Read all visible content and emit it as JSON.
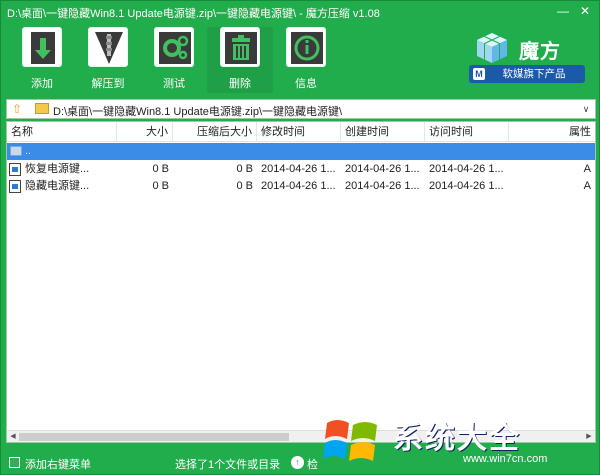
{
  "window": {
    "title": "D:\\桌面\\一键隐藏Win8.1 Update电源键.zip\\一键隐藏电源键\\ - 魔方压缩 v1.08",
    "minimize": "—",
    "close": "✕"
  },
  "toolbar": {
    "buttons": [
      {
        "label": "添加",
        "icon": "add-icon"
      },
      {
        "label": "解压到",
        "icon": "extract-icon"
      },
      {
        "label": "测试",
        "icon": "test-icon"
      },
      {
        "label": "删除",
        "icon": "delete-icon"
      },
      {
        "label": "信息",
        "icon": "info-icon"
      }
    ]
  },
  "brand": {
    "name": "魔方",
    "sub": "软媒旗下产品",
    "sub_icon": "M"
  },
  "address": {
    "up_icon": "⇧",
    "path": "D:\\桌面\\一键隐藏Win8.1 Update电源键.zip\\一键隐藏电源键\\",
    "dropdown": "∨"
  },
  "list": {
    "columns": [
      "名称",
      "大小",
      "压缩后大小",
      "修改时间",
      "创建时间",
      "访问时间",
      "属性"
    ],
    "up_row": "..",
    "rows": [
      {
        "name": "恢复电源键...",
        "size": "0 B",
        "packed": "0 B",
        "modified": "2014-04-26 1...",
        "created": "2014-04-26 1...",
        "accessed": "2014-04-26 1...",
        "attr": "A"
      },
      {
        "name": "隐藏电源键...",
        "size": "0 B",
        "packed": "0 B",
        "modified": "2014-04-26 1...",
        "created": "2014-04-26 1...",
        "accessed": "2014-04-26 1...",
        "attr": "A"
      }
    ]
  },
  "status": {
    "context_menu": "添加右键菜单",
    "message": "选择了1个文件或目录",
    "check_label": "检"
  },
  "watermark": {
    "text": "系统大全",
    "url": "www.win7cn.com"
  },
  "colors": {
    "window_bg": "#22ad4d",
    "selected_row": "#3b8ce6",
    "brand_badge": "#1b5aa8"
  }
}
